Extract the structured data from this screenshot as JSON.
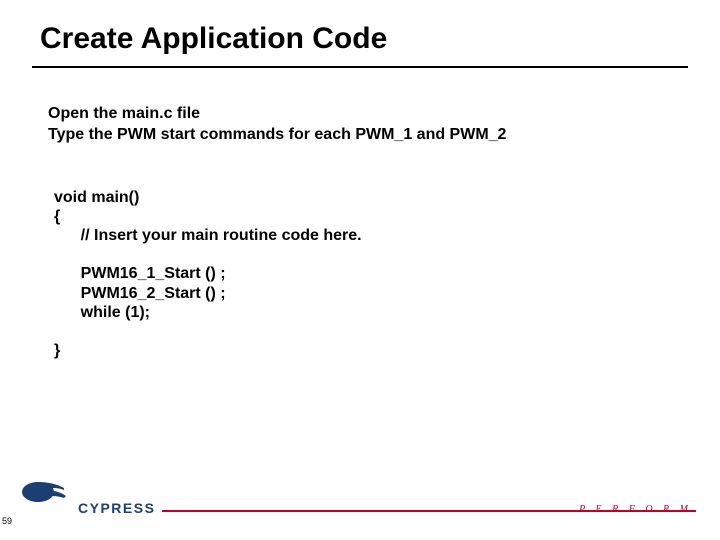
{
  "title": "Create Application Code",
  "instructions": {
    "line1": "Open the main.c file",
    "line2": "Type the PWM start commands for each PWM_1 and PWM_2"
  },
  "code": {
    "line1": "void main()",
    "line2": "{",
    "line3": "      // Insert your main routine code here.",
    "line4": "",
    "line5": "      PWM16_1_Start () ;",
    "line6": "      PWM16_2_Start () ;",
    "line7": "      while (1);",
    "line8": "",
    "line9": "}"
  },
  "footer": {
    "logo_wordmark": "CYPRESS",
    "tagline": "P E R F O R M",
    "page_number": "59"
  }
}
